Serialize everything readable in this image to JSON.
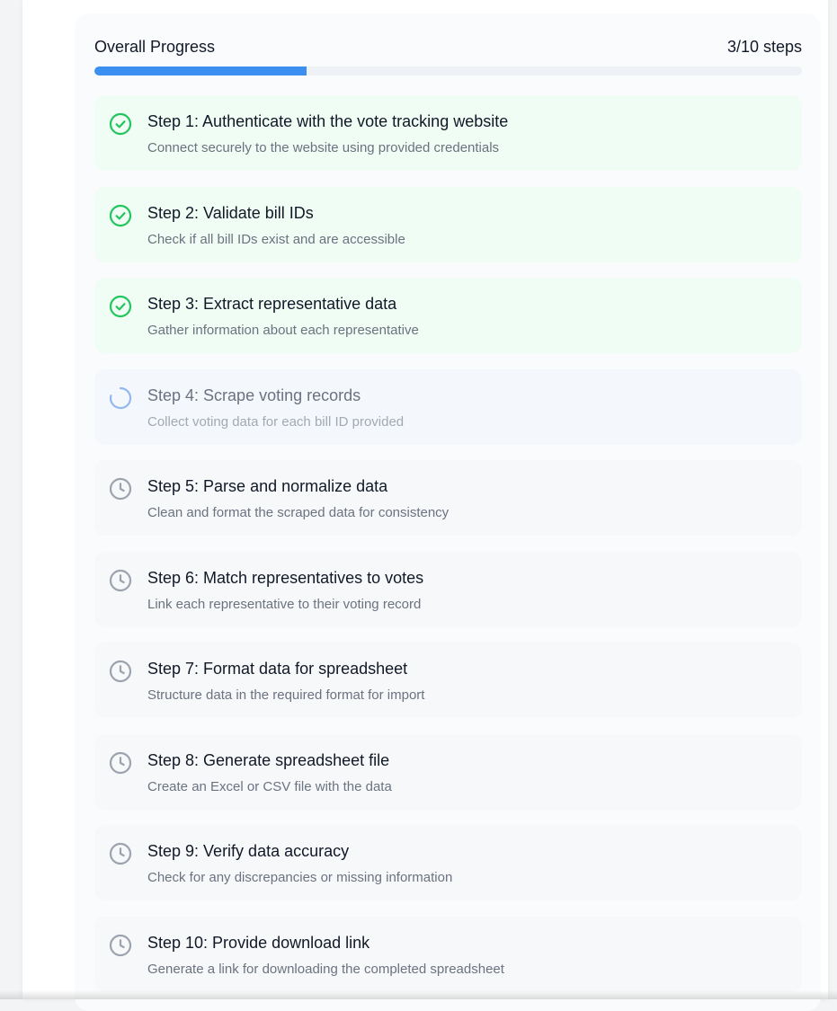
{
  "progress": {
    "title": "Overall Progress",
    "count_label": "3/10 steps",
    "completed": 3,
    "total": 10,
    "fraction": 0.3,
    "color": "#3b8ff0"
  },
  "status_colors": {
    "completed": "#22c55e",
    "in_progress": "#93b8f0",
    "pending": "#9ca3af"
  },
  "steps": [
    {
      "title": "Step 1: Authenticate with the vote tracking website",
      "description": "Connect securely to the website using provided credentials",
      "status": "completed",
      "icon": "check-circle-icon"
    },
    {
      "title": "Step 2: Validate bill IDs",
      "description": "Check if all bill IDs exist and are accessible",
      "status": "completed",
      "icon": "check-circle-icon"
    },
    {
      "title": "Step 3: Extract representative data",
      "description": "Gather information about each representative",
      "status": "completed",
      "icon": "check-circle-icon"
    },
    {
      "title": "Step 4: Scrape voting records",
      "description": "Collect voting data for each bill ID provided",
      "status": "in_progress",
      "icon": "spinner-icon"
    },
    {
      "title": "Step 5: Parse and normalize data",
      "description": "Clean and format the scraped data for consistency",
      "status": "pending",
      "icon": "clock-icon"
    },
    {
      "title": "Step 6: Match representatives to votes",
      "description": "Link each representative to their voting record",
      "status": "pending",
      "icon": "clock-icon"
    },
    {
      "title": "Step 7: Format data for spreadsheet",
      "description": "Structure data in the required format for import",
      "status": "pending",
      "icon": "clock-icon"
    },
    {
      "title": "Step 8: Generate spreadsheet file",
      "description": "Create an Excel or CSV file with the data",
      "status": "pending",
      "icon": "clock-icon"
    },
    {
      "title": "Step 9: Verify data accuracy",
      "description": "Check for any discrepancies or missing information",
      "status": "pending",
      "icon": "clock-icon"
    },
    {
      "title": "Step 10: Provide download link",
      "description": "Generate a link for downloading the completed spreadsheet",
      "status": "pending",
      "icon": "clock-icon"
    }
  ]
}
